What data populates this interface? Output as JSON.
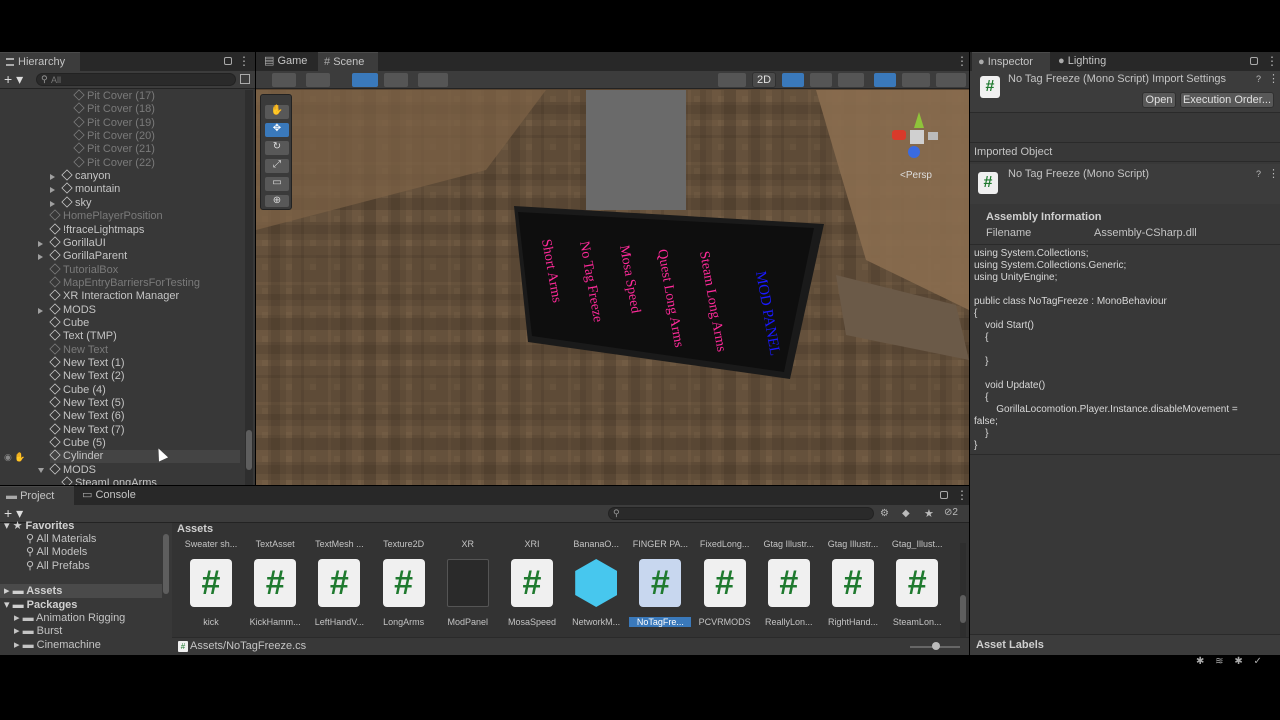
{
  "hierarchy": {
    "tab": "Hierarchy",
    "search_placeholder": "All",
    "items": [
      {
        "label": "Pit Cover (17)",
        "dim": true
      },
      {
        "label": "Pit Cover (18)",
        "dim": true
      },
      {
        "label": "Pit Cover (19)",
        "dim": true
      },
      {
        "label": "Pit Cover (20)",
        "dim": true
      },
      {
        "label": "Pit Cover (21)",
        "dim": true
      },
      {
        "label": "Pit Cover (22)",
        "dim": true
      },
      {
        "label": "canyon",
        "dim": false
      },
      {
        "label": "mountain",
        "dim": false
      },
      {
        "label": "sky",
        "dim": false
      },
      {
        "label": "HomePlayerPosition",
        "dim": true
      },
      {
        "label": "!ftraceLightmaps",
        "dim": false
      },
      {
        "label": "GorillaUI",
        "dim": false
      },
      {
        "label": "GorillaParent",
        "dim": false
      },
      {
        "label": "TutorialBox",
        "dim": true
      },
      {
        "label": "MapEntryBarriersForTesting",
        "dim": true
      },
      {
        "label": "XR Interaction Manager",
        "dim": false
      },
      {
        "label": "MODS",
        "dim": false
      },
      {
        "label": "Cube",
        "dim": false
      },
      {
        "label": "Text (TMP)",
        "dim": false
      },
      {
        "label": "New Text",
        "dim": true
      },
      {
        "label": "New Text (1)",
        "dim": false
      },
      {
        "label": "New Text (2)",
        "dim": false
      },
      {
        "label": "Cube (4)",
        "dim": false
      },
      {
        "label": "New Text (5)",
        "dim": false
      },
      {
        "label": "New Text (6)",
        "dim": false
      },
      {
        "label": "New Text (7)",
        "dim": false
      },
      {
        "label": "Cube (5)",
        "dim": false
      },
      {
        "label": "Cylinder",
        "dim": false
      },
      {
        "label": "MODS",
        "dim": false
      },
      {
        "label": "SteamLongArms",
        "dim": false
      }
    ]
  },
  "scene": {
    "tab_game": "Game",
    "tab_scene": "Scene",
    "btn_2d": "2D",
    "persp": "<Persp",
    "panel_texts": [
      "Short Arms",
      "No Tag Freeze",
      "Mosa Speed",
      "Quest Long Arms",
      "Steam Long Arms",
      "MOD PANEL"
    ]
  },
  "inspector": {
    "tab": "Inspector",
    "tab2": "Lighting",
    "title": "No Tag Freeze (Mono Script) Import Settings",
    "open": "Open",
    "exec": "Execution Order...",
    "imported_object": "Imported Object",
    "script_name": "No Tag Freeze (Mono Script)",
    "assembly_info": "Assembly Information",
    "filename_label": "Filename",
    "filename_value": "Assembly-CSharp.dll",
    "code": "using System.Collections;\nusing System.Collections.Generic;\nusing UnityEngine;\n\npublic class NoTagFreeze : MonoBehaviour\n{\n    void Start()\n    {\n\n    }\n\n    void Update()\n    {\n        GorillaLocomotion.Player.Instance.disableMovement =\nfalse;\n    }\n}",
    "asset_labels": "Asset Labels"
  },
  "project": {
    "tab": "Project",
    "tab2": "Console",
    "hidden_count": "2",
    "favorites": "Favorites",
    "fav_items": [
      "All Materials",
      "All Models",
      "All Prefabs"
    ],
    "assets": "Assets",
    "packages": "Packages",
    "pkg_items": [
      "Animation Rigging",
      "Burst",
      "Cinemachine"
    ],
    "breadcrumb": "Assets",
    "top_names": [
      "Sweater sh...",
      "TextAsset",
      "TextMesh ...",
      "Texture2D",
      "XR",
      "XRI",
      "BananaO...",
      "FINGER PA...",
      "FixedLong...",
      "Gtag Illustr...",
      "Gtag Illustr...",
      "Gtag_Illust..."
    ],
    "assets_row": [
      {
        "name": "kick",
        "kind": "script"
      },
      {
        "name": "KickHamm...",
        "kind": "script"
      },
      {
        "name": "LeftHandV...",
        "kind": "script"
      },
      {
        "name": "LongArms",
        "kind": "script"
      },
      {
        "name": "ModPanel",
        "kind": "prefab"
      },
      {
        "name": "MosaSpeed",
        "kind": "script"
      },
      {
        "name": "NetworkM...",
        "kind": "cube"
      },
      {
        "name": "NoTagFre...",
        "kind": "script-selected"
      },
      {
        "name": "PCVRMODS",
        "kind": "script"
      },
      {
        "name": "ReallyLon...",
        "kind": "script"
      },
      {
        "name": "RightHand...",
        "kind": "script"
      },
      {
        "name": "SteamLon...",
        "kind": "script"
      }
    ],
    "path": "Assets/NoTagFreeze.cs"
  },
  "icons": {
    "hash": "#",
    "add": "+",
    "menu": "⋮"
  },
  "colors": {
    "accent": "#3a79bb",
    "panel_text": "#ff2a9a",
    "panel_title": "#1a1aff",
    "script_green": "#1f7a2f"
  }
}
